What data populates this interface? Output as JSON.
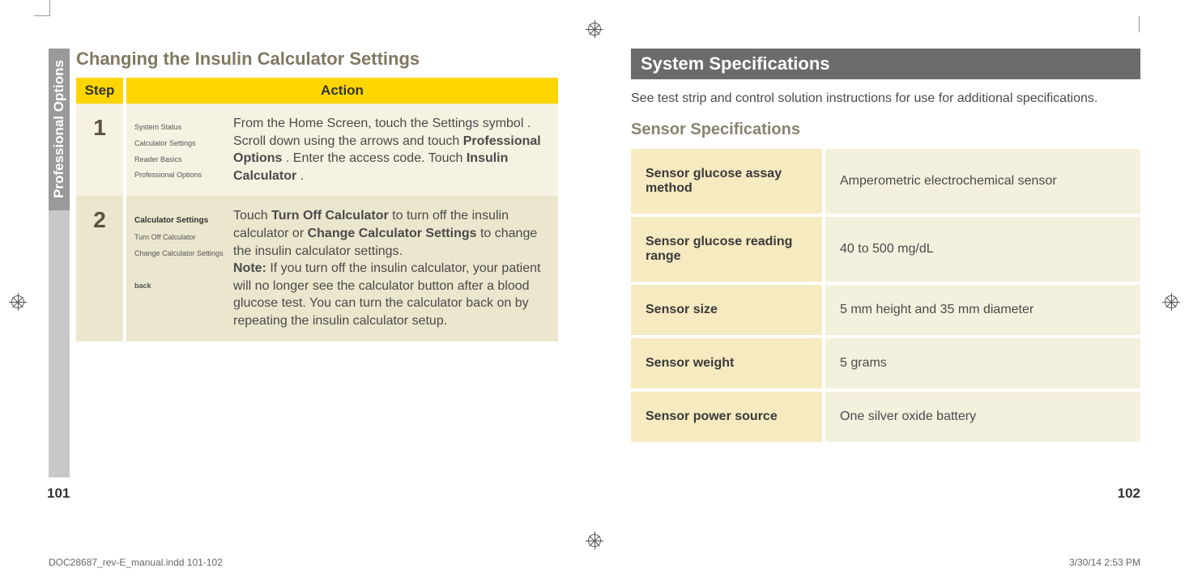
{
  "left": {
    "side_label": "Professional Options",
    "title": "Changing the Insulin Calculator Settings",
    "headers": {
      "step": "Step",
      "action": "Action"
    },
    "steps": [
      {
        "num": "1",
        "screen": {
          "items": [
            "System Status",
            "Calculator Settings",
            "Reader Basics",
            "Professional Options"
          ]
        },
        "text_pre": "From the Home Screen, touch the Settings symbol ",
        "text_mid": ". Scroll down using the arrows and touch ",
        "strong1": "Professional Options",
        "text_mid2": ". Enter the access code. Touch ",
        "strong2": "Insulin Calculator",
        "text_end": "."
      },
      {
        "num": "2",
        "screen": {
          "heading": "Calculator Settings",
          "items": [
            "Turn Off Calculator",
            "Change Calculator Settings"
          ],
          "back": "back"
        },
        "text_pre": "Touch ",
        "strong1": "Turn Off Calculator",
        "text_mid": " to turn off the insulin calculator or ",
        "strong2": "Change Calculator Settings",
        "text_mid2": " to change the insulin calculator settings.",
        "note_label": "Note:",
        "note_text": " If you turn off the insulin calculator, your patient will no longer see the calculator button after a blood glucose test. You can turn the calculator back on by repeating the insulin calculator setup."
      }
    ],
    "page_num": "101"
  },
  "right": {
    "heading": "System Specifications",
    "intro": "See test strip and control solution instructions for use for additional specifications.",
    "sub_heading": "Sensor Specifications",
    "rows": [
      {
        "label": "Sensor glucose assay method",
        "value": "Amperometric electrochemical sensor"
      },
      {
        "label": "Sensor glucose reading range",
        "value": "40 to 500 mg/dL"
      },
      {
        "label": "Sensor size",
        "value": "5 mm height and 35 mm diameter"
      },
      {
        "label": "Sensor weight",
        "value": "5 grams"
      },
      {
        "label": "Sensor power source",
        "value": "One silver oxide battery"
      }
    ],
    "page_num": "102"
  },
  "footer": {
    "doc": "DOC28687_rev-E_manual.indd   101-102",
    "date": "3/30/14   2:53 PM"
  }
}
